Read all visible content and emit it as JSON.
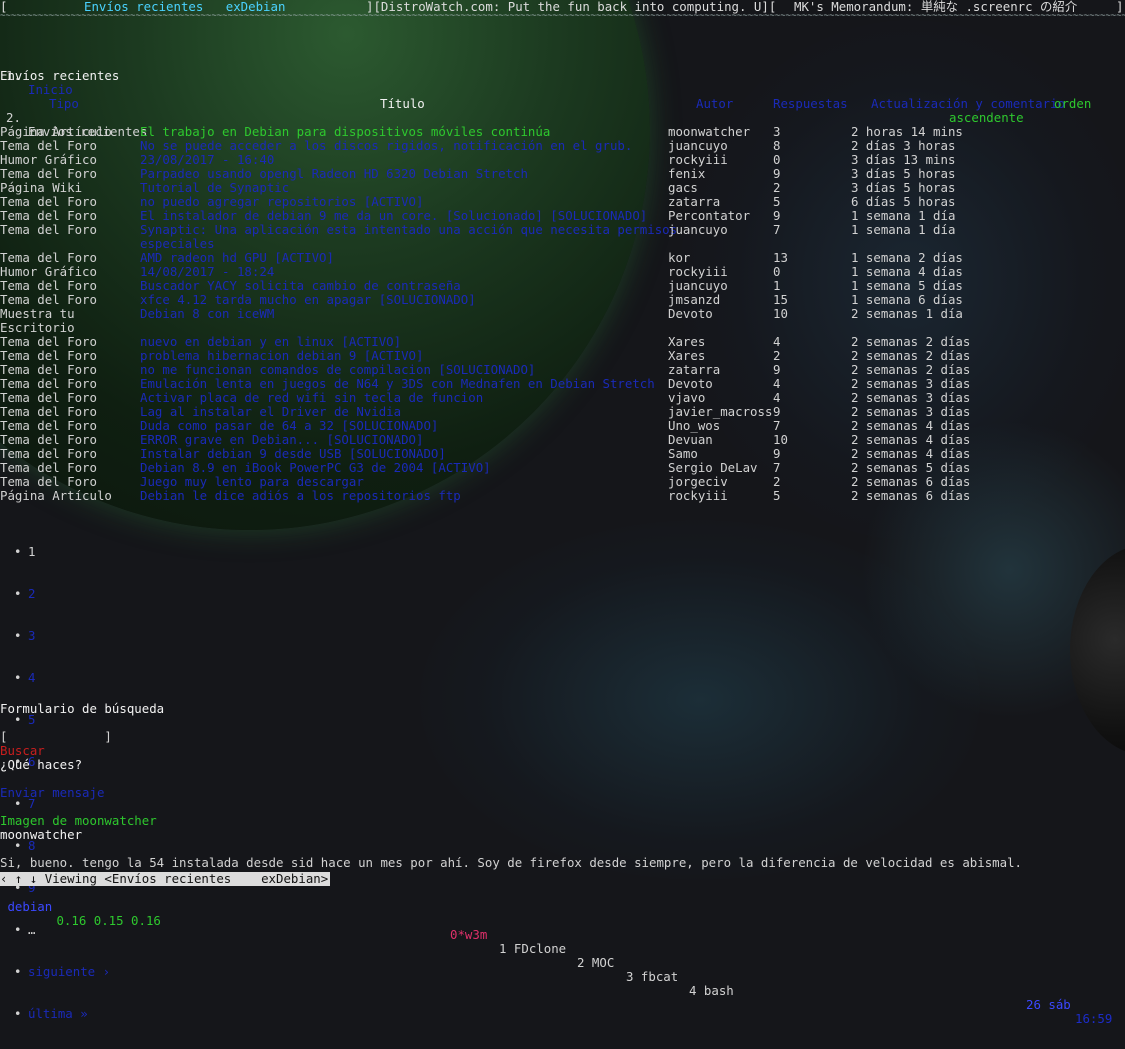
{
  "window": {
    "tabs": [
      "Envíos recientes   exDebian",
      "][DistroWatch.com: Put the fun back into computing. U][",
      "MK's Memorandum: 単純な .screenrc の紹介"
    ],
    "open_bracket": "[",
    "close_bracket": "]",
    "tilde_line": "~~~~~~~~~~~~~~~~~~~~~~~~~~~~~~~~~~~~~~~~~~~~~~~~~~~~~~~~~~~~~~~~~~~~~~~~~~~~~~~~~~~~~~~~~~~~~~~~~~~~~~~~~~~~~~~~~~~~~~~~~~~~~~~~~~~~~~~~~~~~~~~~~~~~~~~~~~~~~~~~~~~~~~~~~~~~~~~~~~~~~~~~~~~~~~~~~~~~~~~~~~~~~~~~~~~~~~~~~"
  },
  "breadcrumb": [
    {
      "num": "1.",
      "label": "Inicio"
    },
    {
      "num": "2.",
      "label": "Envíos recientes"
    }
  ],
  "page_title": "Envíos recientes",
  "table": {
    "headers": {
      "type": "Tipo",
      "title": "Título",
      "author": "Autor",
      "replies": "Respuestas",
      "activity": "Actualización y comentario",
      "order1": "orden",
      "order2": "ascendente"
    },
    "rows": [
      {
        "type": "Página Artículo",
        "title": "El trabajo en Debian para dispositivos móviles continúa",
        "author": "moonwatcher",
        "replies": "3",
        "activity": "2 horas 14 mins"
      },
      {
        "type": "Tema del Foro",
        "title": "No se puede acceder a los discos rigidos, notificación en el grub.",
        "author": "juancuyo",
        "replies": "8",
        "activity": "2 días 3 horas"
      },
      {
        "type": "Humor Gráfico",
        "title": "23/08/2017 - 16:40",
        "author": "rockyiii",
        "replies": "0",
        "activity": "3 días 13 mins"
      },
      {
        "type": "Tema del Foro",
        "title": "Parpadeo usando opengl Radeon HD 6320 Debian Stretch",
        "author": "fenix",
        "replies": "9",
        "activity": "3 días 5 horas"
      },
      {
        "type": "Página Wiki",
        "title": "Tutorial de Synaptic",
        "author": "gacs",
        "replies": "2",
        "activity": "3 días 5 horas"
      },
      {
        "type": "Tema del Foro",
        "title": "no puedo agregar repositorios [ACTIVO]",
        "author": "zatarra",
        "replies": "5",
        "activity": "6 días 5 horas"
      },
      {
        "type": "Tema del Foro",
        "title": "El instalador de debian 9 me da un core. [Solucionado] [SOLUCIONADO]",
        "author": "Percontator",
        "replies": "9",
        "activity": "1 semana 1 día"
      },
      {
        "type": "Tema del Foro",
        "title": "Synaptic: Una aplicación esta intentado una acción que necesita permisos",
        "title2": "especiales",
        "author": "juancuyo",
        "replies": "7",
        "activity": "1 semana 1 día"
      },
      {
        "type": "Tema del Foro",
        "title": "AMD radeon hd GPU [ACTIVO]",
        "author": "kor",
        "replies": "13",
        "activity": "1 semana 2 días"
      },
      {
        "type": "Humor Gráfico",
        "title": "14/08/2017 - 18:24",
        "author": "rockyiii",
        "replies": "0",
        "activity": "1 semana 4 días"
      },
      {
        "type": "Tema del Foro",
        "title": "Buscador YACY solicita cambio de contraseña",
        "author": "juancuyo",
        "replies": "1",
        "activity": "1 semana 5 días"
      },
      {
        "type": "Tema del Foro",
        "title": "xfce 4.12 tarda mucho en apagar [SOLUCIONADO]",
        "author": "jmsanzd",
        "replies": "15",
        "activity": "1 semana 6 días"
      },
      {
        "type": "Muestra tu",
        "type2": "Escritorio",
        "title": "Debian 8 con iceWM",
        "author": "Devoto",
        "replies": "10",
        "activity": "2 semanas 1 día"
      },
      {
        "type": "Tema del Foro",
        "title": "nuevo en debian y en linux [ACTIVO]",
        "author": "Xares",
        "replies": "4",
        "activity": "2 semanas 2 días"
      },
      {
        "type": "Tema del Foro",
        "title": "problema hibernacion debian 9 [ACTIVO]",
        "author": "Xares",
        "replies": "2",
        "activity": "2 semanas 2 días"
      },
      {
        "type": "Tema del Foro",
        "title": "no me funcionan comandos de compilacion [SOLUCIONADO]",
        "author": "zatarra",
        "replies": "9",
        "activity": "2 semanas 2 días"
      },
      {
        "type": "Tema del Foro",
        "title": "Emulación lenta en juegos de N64 y 3DS con Mednafen en Debian Stretch",
        "author": "Devoto",
        "replies": "4",
        "activity": "2 semanas 3 días"
      },
      {
        "type": "Tema del Foro",
        "title": "Activar placa de red wifi sin tecla de funcion",
        "author": "vjavo",
        "replies": "4",
        "activity": "2 semanas 3 días"
      },
      {
        "type": "Tema del Foro",
        "title": "Lag al instalar el Driver de Nvidia",
        "author": "javier_macross",
        "replies": "9",
        "activity": "2 semanas 3 días"
      },
      {
        "type": "Tema del Foro",
        "title": "Duda como pasar de 64 a 32 [SOLUCIONADO]",
        "author": "Uno_wos",
        "replies": "7",
        "activity": "2 semanas 4 días"
      },
      {
        "type": "Tema del Foro",
        "title": "ERROR grave en Debian... [SOLUCIONADO]",
        "author": "Devuan",
        "replies": "10",
        "activity": "2 semanas 4 días"
      },
      {
        "type": "Tema del Foro",
        "title": "Instalar debian 9 desde USB [SOLUCIONADO]",
        "author": "Samo",
        "replies": "9",
        "activity": "2 semanas 4 días"
      },
      {
        "type": "Tema del Foro",
        "title": "Debian 8.9 en iBook PowerPC G3 de 2004 [ACTIVO]",
        "author": "Sergio DeLav",
        "replies": "7",
        "activity": "2 semanas 5 días"
      },
      {
        "type": "Tema del Foro",
        "title": "Juego muy lento para descargar",
        "author": "jorgeciv",
        "replies": "2",
        "activity": "2 semanas 6 días"
      },
      {
        "type": "Página Artículo",
        "title": "Debian le dice adiós a los repositorios ftp",
        "author": "rockyiii",
        "replies": "5",
        "activity": "2 semanas 6 días"
      }
    ]
  },
  "pager": {
    "bullet": "•",
    "current": "1",
    "pages": [
      "2",
      "3",
      "4",
      "5",
      "6",
      "7",
      "8",
      "9"
    ],
    "ellipsis": "…",
    "next": "siguiente ›",
    "last": "última »"
  },
  "search": {
    "heading": "Formulario de búsqueda",
    "field_value": "[             ]",
    "button": "Buscar"
  },
  "status": {
    "heading": "¿Qué haces?",
    "send": "Enviar mensaje",
    "image_alt": "Imagen de moonwatcher",
    "user": "moonwatcher",
    "message": "Si, bueno. tengo la 54 instalada desde sid hace un mes por ahí. Soy de firefox desde siempre, pero la diferencia de velocidad es abismal."
  },
  "statusbar": {
    "text": "‹ ↑ ↓ Viewing <Envíos recientes    exDebian>"
  },
  "screenbar": {
    "host": " debian",
    "load": " 0.16 0.15 0.16",
    "windows": [
      {
        "label": "0*w3m",
        "active": true
      },
      {
        "label": "1 FDclone",
        "active": false
      },
      {
        "label": "2 MOC",
        "active": false
      },
      {
        "label": "3 fbcat",
        "active": false
      },
      {
        "label": "4 bash",
        "active": false
      }
    ],
    "date": "26 sáb",
    "time": "16:59"
  },
  "colors": {
    "link": "#1a2ab8",
    "green": "#2ec82e",
    "red": "#c81e1e",
    "active_window": "#e0306a",
    "time": "#1c2cc8"
  }
}
